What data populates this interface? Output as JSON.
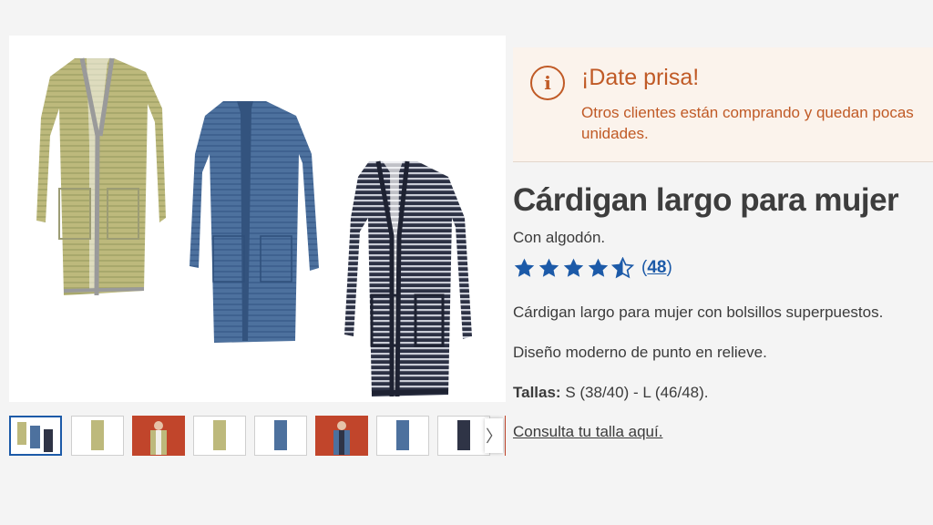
{
  "notice": {
    "icon": "info-icon",
    "title": "¡Date prisa!",
    "text": "Otros clientes están comprando y quedan pocas unidades."
  },
  "product": {
    "title": "Cárdigan largo para mujer",
    "subtitle": "Con algodón.",
    "rating": {
      "stars": 4.5,
      "max": 5,
      "open_paren": "(",
      "count": "48",
      "close_paren": ")"
    },
    "description_1": "Cárdigan largo para mujer con bolsillos superpuestos.",
    "description_2": "Diseño moderno de punto en relieve.",
    "sizes_label": "Tallas:",
    "sizes_value": "S (38/40) - L (46/48).",
    "size_link": "Consulta tu talla aquí."
  },
  "gallery": {
    "next_arrow": "〉",
    "thumbnails": [
      {
        "name": "thumb-trio",
        "selected": true
      },
      {
        "name": "thumb-green"
      },
      {
        "name": "thumb-model-green"
      },
      {
        "name": "thumb-green-2"
      },
      {
        "name": "thumb-blue"
      },
      {
        "name": "thumb-model-blue"
      },
      {
        "name": "thumb-blue-2"
      },
      {
        "name": "thumb-navy"
      }
    ]
  },
  "colors": {
    "accent_orange": "#c05a26",
    "notice_bg": "#fbf3ec",
    "star_blue": "#1c5aa8",
    "cardigan_green": "#b9b57a",
    "cardigan_blue": "#4a6e9c",
    "cardigan_navy": "#2f3446"
  }
}
